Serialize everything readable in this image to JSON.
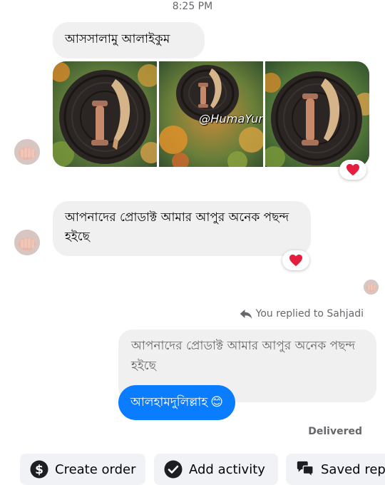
{
  "header": {
    "timestamp": "8:25 PM"
  },
  "conversation": {
    "greeting_message": "আসসালামু আলাইকুম",
    "photo_watermark": "@HumaYun's Mart",
    "photo_reaction": "heart",
    "compliment_message": "আপনাদের প্রোডাক্ট আমার আপুর অনেক পছন্দ হইছে",
    "compliment_reaction": "heart",
    "reply_note": "You replied to Sahjadi",
    "quoted_message": "আপনাদের প্রোডাক্ট আমার আপুর অনেক পছন্দ হইছে",
    "reply_message": "আলহামদুলিল্লাহ",
    "reply_emoji": "😊",
    "delivery_status": "Delivered"
  },
  "quick_actions": [
    {
      "label": "Create order",
      "icon": "dollar-icon"
    },
    {
      "label": "Add activity",
      "icon": "check-circle-icon"
    },
    {
      "label": "Saved rep",
      "icon": "saved-replies-icon"
    }
  ],
  "colors": {
    "outgoing_bubble": "#0a7cff",
    "incoming_bubble": "#f0f0f0",
    "reaction_heart": "#e41e3f",
    "secondary_text": "#65676b"
  }
}
